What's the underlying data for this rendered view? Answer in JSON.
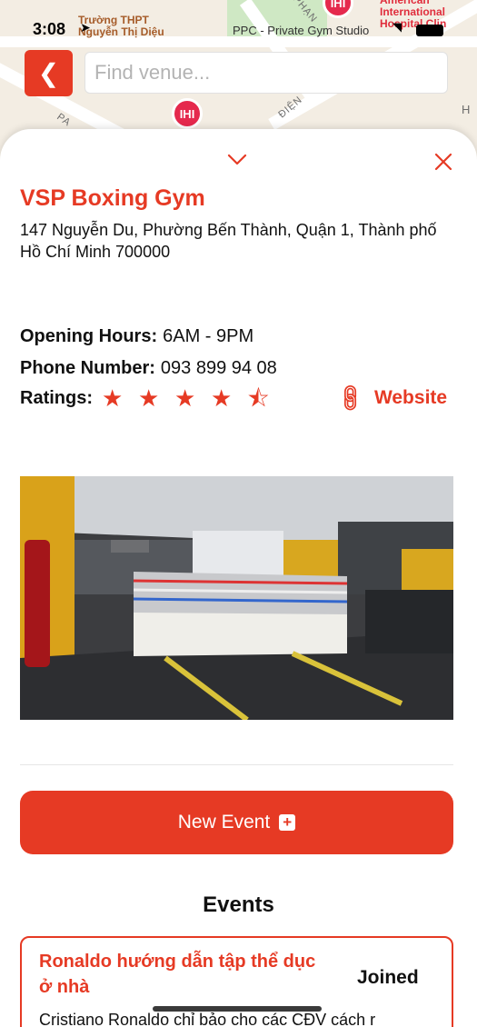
{
  "status_bar": {
    "time": "3:08",
    "location_icon": "location-arrow-icon",
    "wifi_icon": "wifi-icon",
    "battery_icon": "battery-icon"
  },
  "map": {
    "labels": {
      "school": "Trường THPT\nNguyễn Thị Diệu",
      "gym": "PPC - Private Gym Studio",
      "clinic": "American\nInternational\nHospital Clin",
      "street_dien": "ĐIỆN",
      "street_phan": "PHẠN",
      "street_pa": "PA",
      "edge_h": "H"
    },
    "pin_icon": "dumbbell-icon",
    "pin_text": "IHI"
  },
  "header": {
    "back_icon": "chevron-left-icon",
    "search_placeholder": "Find venue..."
  },
  "venue": {
    "name": "VSP Boxing Gym",
    "address": "147 Nguyễn Du, Phường Bến Thành, Quận 1, Thành phố Hồ Chí Minh 700000",
    "opening_hours_label": "Opening Hours:",
    "opening_hours": "6AM - 9PM",
    "phone_label": "Phone Number:",
    "phone": "093 899 94 08",
    "ratings_label": "Ratings:",
    "rating": 4.5,
    "rating_max": 5,
    "website_label": "Website",
    "website_icon": "link-icon"
  },
  "sheet": {
    "collapse_icon": "chevron-down-icon",
    "close_icon": "close-icon"
  },
  "actions": {
    "new_event_label": "New Event",
    "new_event_icon": "plus-square-icon"
  },
  "events": {
    "title": "Events",
    "items": [
      {
        "title": "Ronaldo hướng dẫn tập thể dục ở nhà",
        "status": "Joined",
        "description": "Cristiano Ronaldo chỉ bảo cho các CĐV cách r"
      }
    ]
  },
  "colors": {
    "accent": "#e63a24",
    "pin": "#e5294d"
  }
}
